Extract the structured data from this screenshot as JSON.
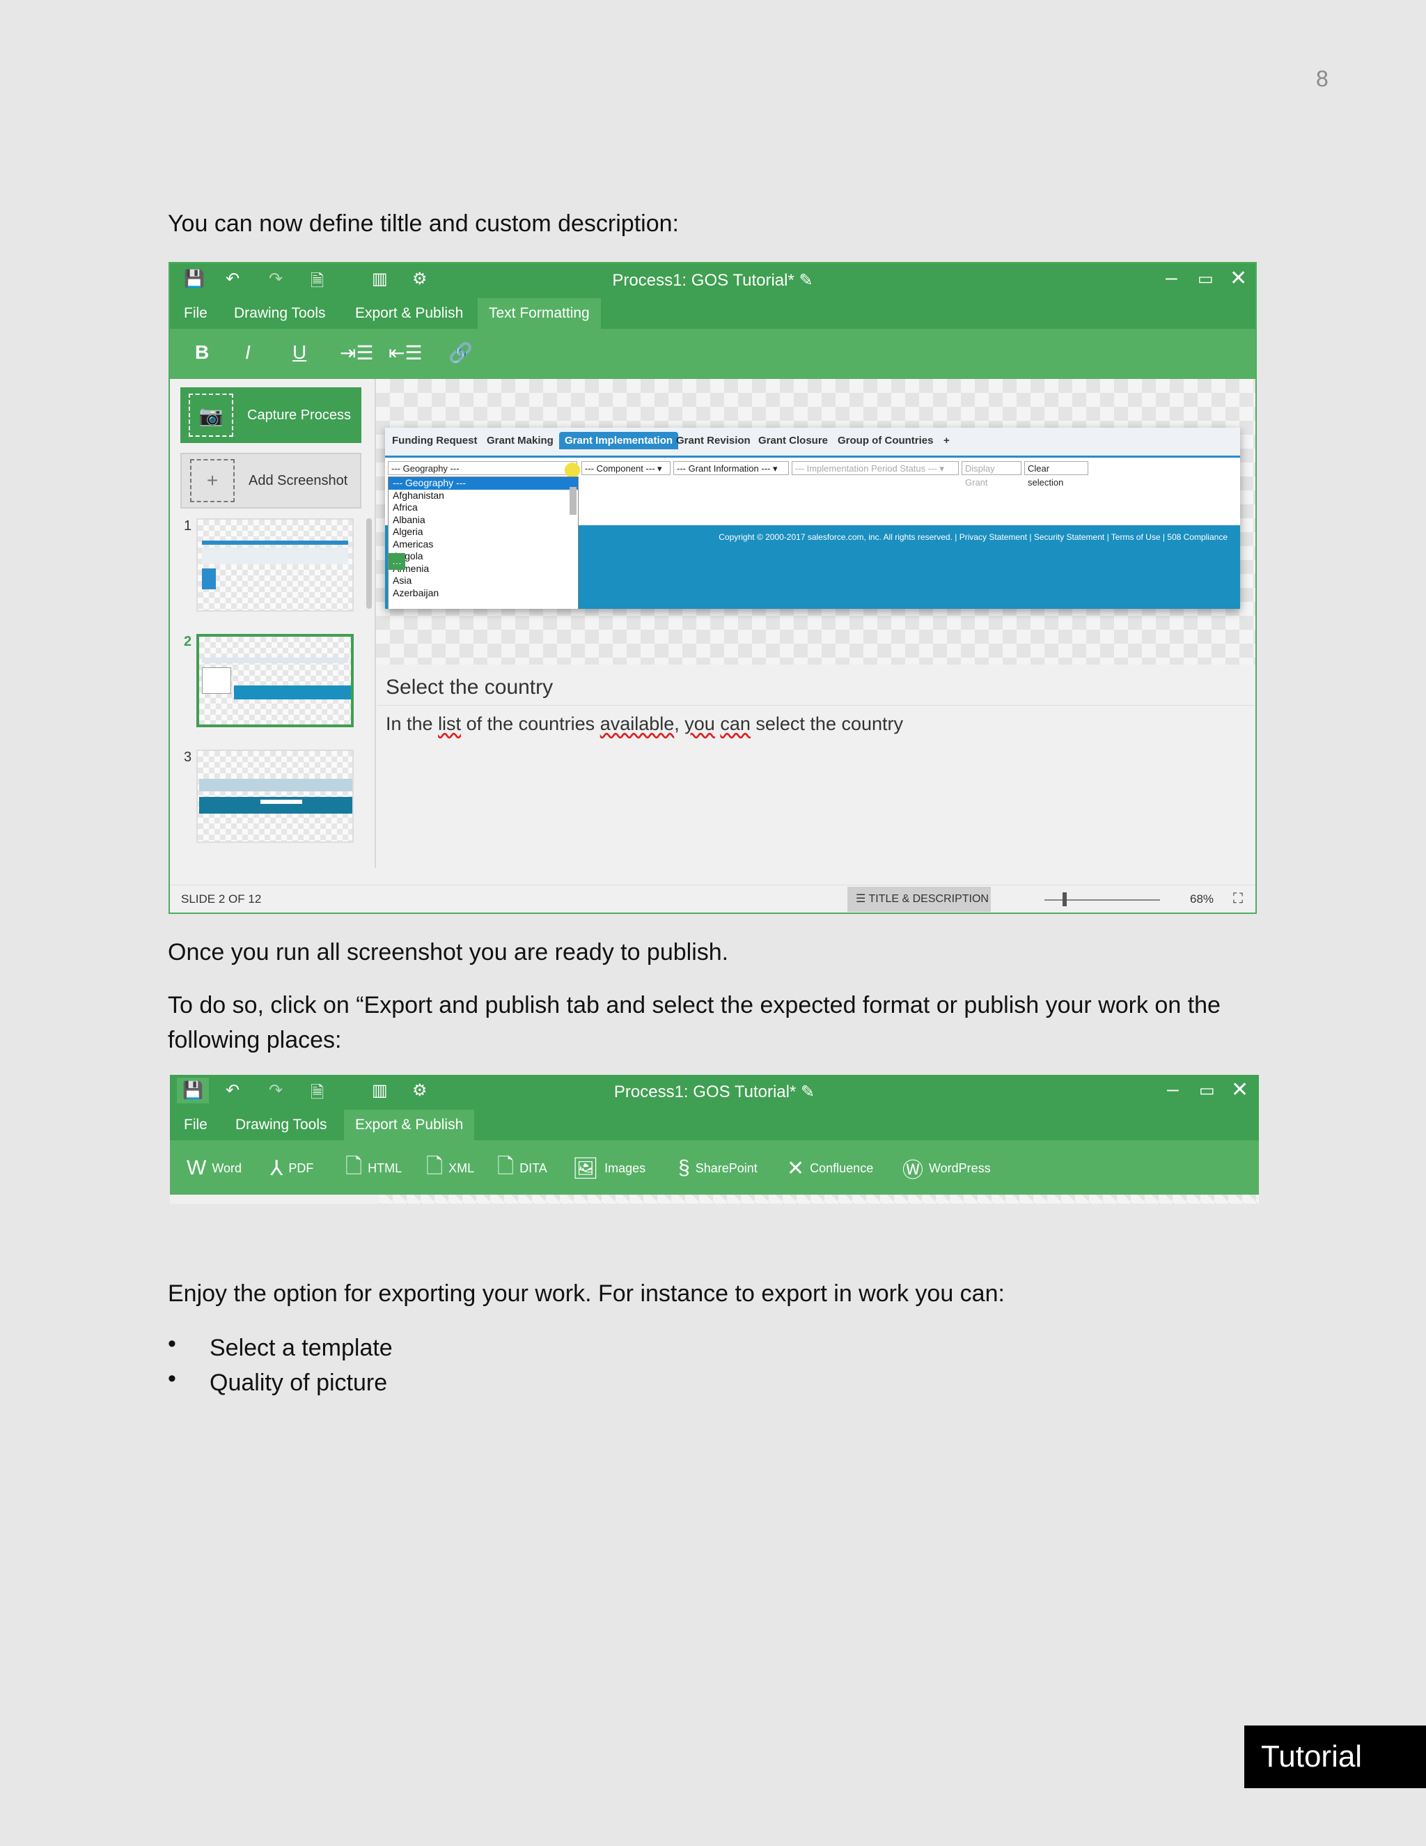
{
  "page_number": "8",
  "para1": "You can now define tiltle and custom description:",
  "para2": "Once you run all screenshot you are ready to publish.",
  "para3_line1": "To do so, click on “Export and publish tab and select the expected format or publish your work on the",
  "para3_line2": "following places:",
  "para4": "Enjoy the option for exporting your work. For instance to export in work you can:",
  "bullets": [
    "Select a template",
    "Quality of picture"
  ],
  "footer_tag": "Tutorial",
  "app": {
    "title": "Process1: GOS Tutorial*",
    "menu1": [
      "File",
      "Drawing Tools",
      "Export & Publish",
      "Text Formatting"
    ],
    "menu2": [
      "File",
      "Drawing Tools",
      "Export & Publish"
    ],
    "format_tools": [
      "B",
      "I",
      "U"
    ],
    "capture_label": "Capture Process",
    "add_screenshot_label": "Add Screenshot",
    "thumbs": [
      "1",
      "2",
      "3"
    ],
    "inner": {
      "tabs": [
        "Funding Request",
        "Grant Making",
        "Grant Implementation",
        "Grant Revision",
        "Grant Closure",
        "Group of Countries",
        "+"
      ],
      "filters": [
        "--- Geography ---",
        "--- Component --- ▾",
        "--- Grant Information --- ▾",
        "--- Implementation Period Status --- ▾",
        "Display Grant",
        "Clear selection"
      ],
      "dropdown": [
        "--- Geography ---",
        "Afghanistan",
        "Africa",
        "Albania",
        "Algeria",
        "Americas",
        "Angola",
        "Armenia",
        "Asia",
        "Azerbaijan"
      ],
      "copyright": "Copyright © 2000-2017 salesforce.com, inc. All rights reserved. | Privacy Statement | Security Statement | Terms of Use | 508 Compliance"
    },
    "slide_title": "Select the country",
    "slide_desc_parts": [
      "In the ",
      "list",
      " of ",
      "the countries ",
      "available",
      ", ",
      "you",
      " ",
      "can",
      " select the country"
    ],
    "status_left": "SLIDE 2 OF 12",
    "status_mode": "TITLE & DESCRIPTION",
    "zoom": "68%",
    "export_buttons": [
      "Word",
      "PDF",
      "HTML",
      "XML",
      "DITA",
      "Images",
      "SharePoint",
      "Confluence",
      "WordPress"
    ]
  },
  "colors": {
    "green_dark": "#3f9f52",
    "green": "#55b064",
    "blue": "#1a8fc0"
  }
}
